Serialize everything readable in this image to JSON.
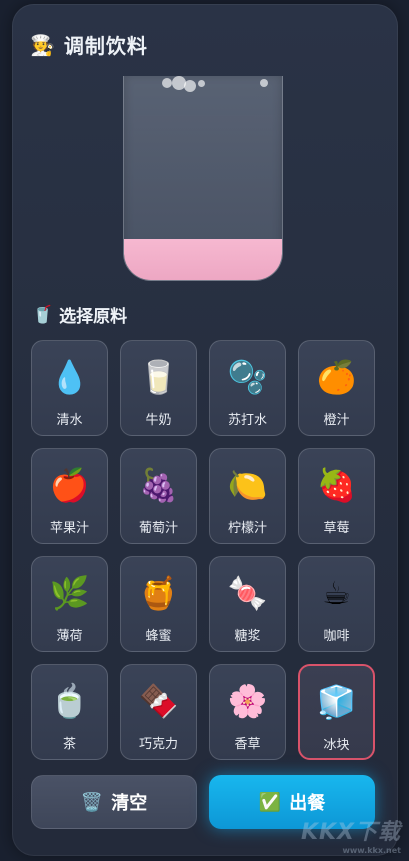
{
  "header": {
    "title": "调制饮料",
    "icon": "chef-icon",
    "icon_glyph": "🧑‍🍳"
  },
  "cup": {
    "liquid_fill_fraction": 0.2,
    "liquid_color": "#f4b4cc"
  },
  "section": {
    "title": "选择原料",
    "icon": "cup-with-straw-icon",
    "icon_glyph": "🥤"
  },
  "ingredients": [
    {
      "label": "清水",
      "icon": "water-drop-icon",
      "glyph": "💧",
      "selected": false
    },
    {
      "label": "牛奶",
      "icon": "milk-glass-icon",
      "glyph": "🥛",
      "selected": false
    },
    {
      "label": "苏打水",
      "icon": "bubbles-icon",
      "glyph": "🫧",
      "selected": false
    },
    {
      "label": "橙汁",
      "icon": "orange-icon",
      "glyph": "🍊",
      "selected": false
    },
    {
      "label": "苹果汁",
      "icon": "apple-icon",
      "glyph": "🍎",
      "selected": false
    },
    {
      "label": "葡萄汁",
      "icon": "grapes-icon",
      "glyph": "🍇",
      "selected": false
    },
    {
      "label": "柠檬汁",
      "icon": "lemon-icon",
      "glyph": "🍋",
      "selected": false
    },
    {
      "label": "草莓",
      "icon": "strawberry-icon",
      "glyph": "🍓",
      "selected": false
    },
    {
      "label": "薄荷",
      "icon": "herb-leaf-icon",
      "glyph": "🌿",
      "selected": false
    },
    {
      "label": "蜂蜜",
      "icon": "honey-pot-icon",
      "glyph": "🍯",
      "selected": false
    },
    {
      "label": "糖浆",
      "icon": "candy-icon",
      "glyph": "🍬",
      "selected": false
    },
    {
      "label": "咖啡",
      "icon": "coffee-cup-icon",
      "glyph": "☕",
      "selected": false
    },
    {
      "label": "茶",
      "icon": "tea-cup-icon",
      "glyph": "🍵",
      "selected": false
    },
    {
      "label": "巧克力",
      "icon": "chocolate-bar-icon",
      "glyph": "🍫",
      "selected": false
    },
    {
      "label": "香草",
      "icon": "blossom-icon",
      "glyph": "🌸",
      "selected": false
    },
    {
      "label": "冰块",
      "icon": "ice-cube-icon",
      "glyph": "🧊",
      "selected": true
    }
  ],
  "buttons": {
    "clear_label": "清空",
    "clear_icon": "wastebasket-icon",
    "clear_glyph": "🗑️",
    "serve_label": "出餐",
    "serve_icon": "check-mark-icon",
    "serve_glyph": "✅"
  },
  "watermark": {
    "big": "KKX下载",
    "small": "www.kkx.net"
  },
  "colors": {
    "panel_bg": "#262e3f",
    "serve_button": "#12a8e4",
    "selected_border": "#d9536a",
    "liquid": "#f4b4cc"
  }
}
